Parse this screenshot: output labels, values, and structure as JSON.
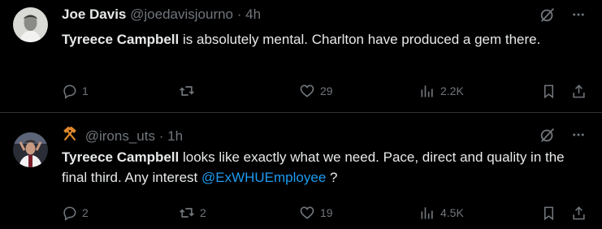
{
  "tweets": [
    {
      "name": "Joe Davis",
      "handle": "@joedavisjourno",
      "separator": "·",
      "time": "4h",
      "text_bold": "Tyreece Campbell",
      "text_rest": " is absolutely mental. Charlton have produced a gem there.",
      "stats": {
        "replies": "1",
        "reposts": "",
        "likes": "29",
        "views": "2.2K"
      }
    },
    {
      "name": "",
      "handle": "@irons_uts",
      "separator": "·",
      "time": "1h",
      "text_bold": "Tyreece Campbell",
      "text_rest": " looks like exactly what we need. Pace, direct and quality in the final third. Any interest ",
      "mention": "@ExWHUEmployee",
      "text_end": " ?",
      "stats": {
        "replies": "2",
        "reposts": "2",
        "likes": "19",
        "views": "4.5K"
      }
    }
  ],
  "colors": {
    "background": "#000000",
    "text": "#e7e9ea",
    "muted": "#71767b",
    "mention": "#1d9bf0",
    "divider": "#2f3336",
    "hammers": "#e08a2c"
  },
  "icons": [
    "grok-icon",
    "more-icon",
    "reply-icon",
    "repost-icon",
    "like-icon",
    "views-icon",
    "bookmark-icon",
    "share-icon",
    "crossed-hammers-icon"
  ]
}
